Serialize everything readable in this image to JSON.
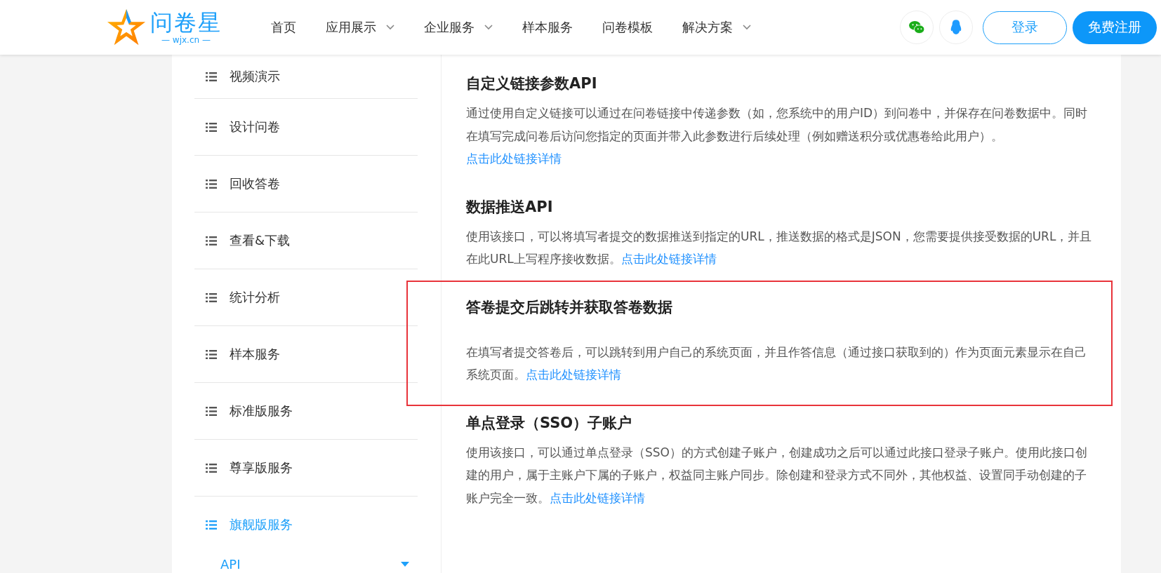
{
  "header": {
    "logo": {
      "name": "问卷星",
      "domain": "— wjx.cn —"
    },
    "nav": [
      {
        "label": "首页",
        "dropdown": false
      },
      {
        "label": "应用展示",
        "dropdown": true
      },
      {
        "label": "企业服务",
        "dropdown": true
      },
      {
        "label": "样本服务",
        "dropdown": false
      },
      {
        "label": "问卷模板",
        "dropdown": false
      },
      {
        "label": "解决方案",
        "dropdown": true
      }
    ],
    "login": "登录",
    "register": "免费注册"
  },
  "sidebar": {
    "items": [
      {
        "label": "视频演示",
        "selected": false
      },
      {
        "label": "设计问卷",
        "selected": false
      },
      {
        "label": "回收答卷",
        "selected": false
      },
      {
        "label": "查看&下载",
        "selected": false
      },
      {
        "label": "统计分析",
        "selected": false
      },
      {
        "label": "样本服务",
        "selected": false
      },
      {
        "label": "标准版服务",
        "selected": false
      },
      {
        "label": "尊享版服务",
        "selected": false
      },
      {
        "label": "旗舰版服务",
        "selected": true
      }
    ],
    "subitem": "API"
  },
  "sections": [
    {
      "title": "自定义链接参数API",
      "text": "通过使用自定义链接可以通过在问卷链接中传递参数（如，您系统中的用户ID）到问卷中，并保存在问卷数据中。同时在填写完成问卷后访问您指定的页面并带入此参数进行后续处理（例如赠送积分或优惠卷给此用户）。",
      "link": "点击此处链接详情",
      "highlighted": false
    },
    {
      "title": "数据推送API",
      "text": "使用该接口，可以将填写者提交的数据推送到指定的URL，推送数据的格式是JSON，您需要提供接受数据的URL，并且在此URL上写程序接收数据。",
      "link": "点击此处链接详情",
      "highlighted": false
    },
    {
      "title": "答卷提交后跳转并获取答卷数据",
      "text": "在填写者提交答卷后，可以跳转到用户自己的系统页面，并且作答信息（通过接口获取到的）作为页面元素显示在自己系统页面。",
      "link": "点击此处链接详情",
      "highlighted": true
    },
    {
      "title": "单点登录（SSO）子账户",
      "text": "使用该接口，可以通过单点登录（SSO）的方式创建子账户，创建成功之后可以通过此接口登录子账户。使用此接口创建的用户，属于主账户下属的子账户，权益同主账户同步。除创建和登录方式不同外，其他权益、设置同手动创建的子账户完全一致。",
      "link": "点击此处链接详情",
      "highlighted": false
    }
  ]
}
